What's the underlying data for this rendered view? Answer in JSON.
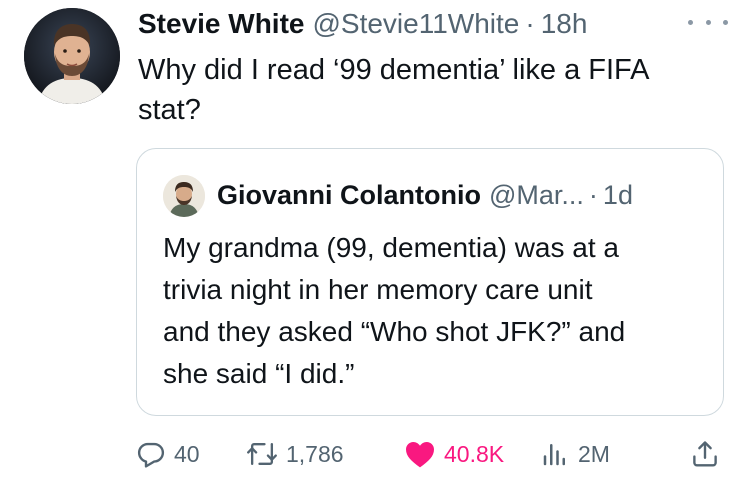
{
  "tweet": {
    "author": {
      "display_name": "Stevie White",
      "handle": "@Stevie11White",
      "separator": "·",
      "time": "18h"
    },
    "text_lines": [
      "Why did I read ‘99 dementia’ like a FIFA",
      "stat?"
    ],
    "quote": {
      "author": {
        "display_name": "Giovanni Colantonio",
        "handle": "@Mar...",
        "separator": "·",
        "time": "1d"
      },
      "text_lines": [
        "My grandma (99, dementia) was at a",
        "trivia night in her memory care unit",
        "and they asked “Who shot JFK?” and",
        "she said “I did.”"
      ]
    },
    "actions": {
      "replies": "40",
      "reposts": "1,786",
      "likes": "40.8K",
      "views": "2M"
    }
  },
  "icons": {
    "reply": "reply-icon",
    "repost": "repost-icon",
    "like": "heart-filled-icon",
    "views": "views-chart-icon",
    "share": "share-icon",
    "more": "more-dots-icon"
  },
  "colors": {
    "text": "#0f1419",
    "secondary": "#536471",
    "like": "#f91880",
    "border": "#cfd9de"
  }
}
